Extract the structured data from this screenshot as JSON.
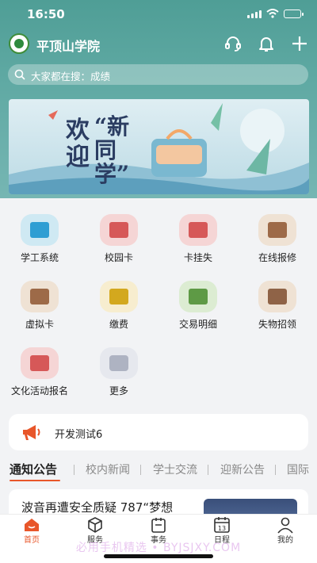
{
  "status": {
    "time": "16:50"
  },
  "header": {
    "school_name": "平顶山学院"
  },
  "search": {
    "placeholder": "大家都在搜：成绩"
  },
  "banner": {
    "line1": "欢",
    "line2": "迎",
    "quote": "“新同学”"
  },
  "grid": [
    {
      "label": "学工系统",
      "icon": "monitor-icon",
      "bg": "#cfe9f3",
      "fg": "#2f9ed3"
    },
    {
      "label": "校园卡",
      "icon": "card-icon",
      "bg": "#f5d5d5",
      "fg": "#d65858"
    },
    {
      "label": "卡挂失",
      "icon": "card-lock-icon",
      "bg": "#f5d5d5",
      "fg": "#d65858"
    },
    {
      "label": "在线报修",
      "icon": "repair-icon",
      "bg": "#efe2d4",
      "fg": "#9d6a48"
    },
    {
      "label": "虚拟卡",
      "icon": "virtual-card-icon",
      "bg": "#efe2d4",
      "fg": "#9d6a48"
    },
    {
      "label": "缴费",
      "icon": "payment-icon",
      "bg": "#f7edcf",
      "fg": "#d3a81e"
    },
    {
      "label": "交易明细",
      "icon": "transaction-icon",
      "bg": "#dcecd2",
      "fg": "#5e9a45"
    },
    {
      "label": "失物招领",
      "icon": "lost-found-icon",
      "bg": "#efe2d4",
      "fg": "#8f6347"
    },
    {
      "label": "文化活动报名",
      "icon": "activity-icon",
      "bg": "#f5d5d5",
      "fg": "#d65858"
    },
    {
      "label": "更多",
      "icon": "more-icon",
      "bg": "#e6e8ee",
      "fg": "#aeb3c2"
    }
  ],
  "notice": {
    "text": "开发测试6"
  },
  "tabs": [
    "通知公告",
    "校内新闻",
    "学士交流",
    "迎新公告",
    "国际"
  ],
  "article": {
    "title": "波音再遭安全质疑 787“梦想"
  },
  "tabbar": [
    {
      "label": "首页",
      "icon": "home-icon"
    },
    {
      "label": "服务",
      "icon": "service-icon"
    },
    {
      "label": "事务",
      "icon": "affairs-icon"
    },
    {
      "label": "日程",
      "icon": "calendar-icon",
      "day": "13"
    },
    {
      "label": "我的",
      "icon": "profile-icon"
    }
  ],
  "watermark": "必用手机精选 • BYJSJXY.COM",
  "colors": {
    "accent": "#e8562a",
    "header": "#4f9e96"
  }
}
